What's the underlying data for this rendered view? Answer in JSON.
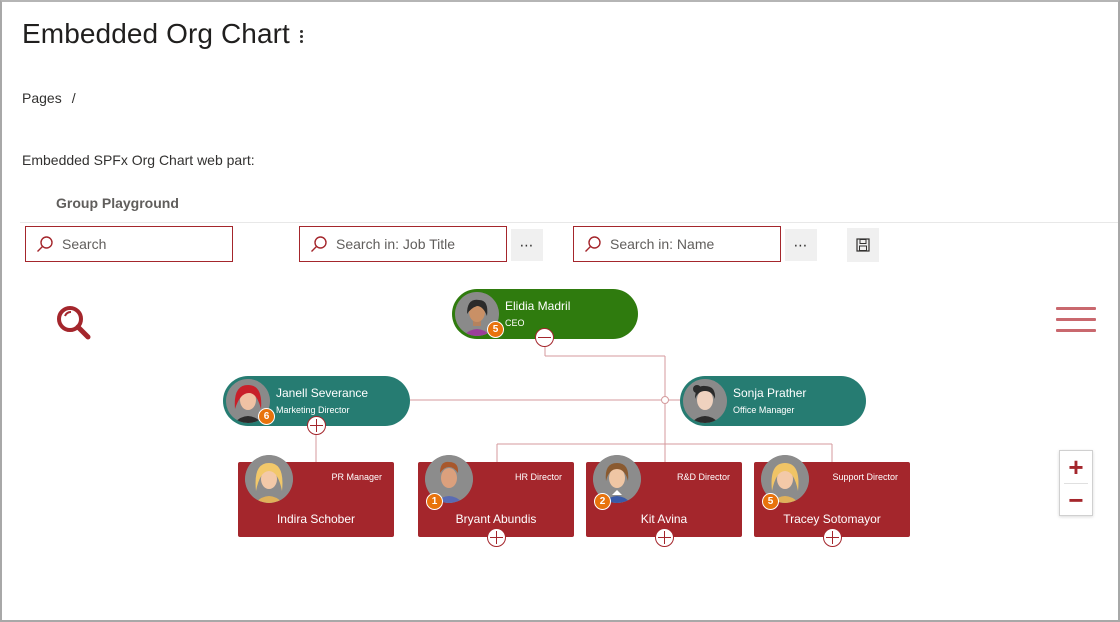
{
  "page": {
    "title": "Embedded Org Chart",
    "breadcrumb_root": "Pages",
    "breadcrumb_sep": "/",
    "intro": "Embedded SPFx Org Chart web part:",
    "webpart_title": "Group Playground"
  },
  "toolbar": {
    "search_placeholder": "Search",
    "job_search_placeholder": "Search in: Job Title",
    "name_search_placeholder": "Search in: Name",
    "more_label": "⋯"
  },
  "zoom": {
    "in_label": "+",
    "out_label": "−"
  },
  "colors": {
    "accent": "#a4262c",
    "ceo_node": "#2f7b0e",
    "manager_node": "#267c72",
    "employee_node": "#a4262c",
    "badge": "#e8730c"
  },
  "org": {
    "ceo": {
      "name": "Elidia Madril",
      "title": "CEO",
      "reports": "5"
    },
    "managers": [
      {
        "name": "Janell Severance",
        "title": "Marketing Director",
        "reports": "6"
      },
      {
        "name": "Sonja Prather",
        "title": "Office Manager",
        "reports": ""
      }
    ],
    "employees": [
      {
        "name": "Indira Schober",
        "title": "PR Manager",
        "reports": ""
      },
      {
        "name": "Bryant Abundis",
        "title": "HR Director",
        "reports": "1"
      },
      {
        "name": "Kit Avina",
        "title": "R&D Director",
        "reports": "2"
      },
      {
        "name": "Tracey Sotomayor",
        "title": "Support Director",
        "reports": "5"
      }
    ]
  }
}
